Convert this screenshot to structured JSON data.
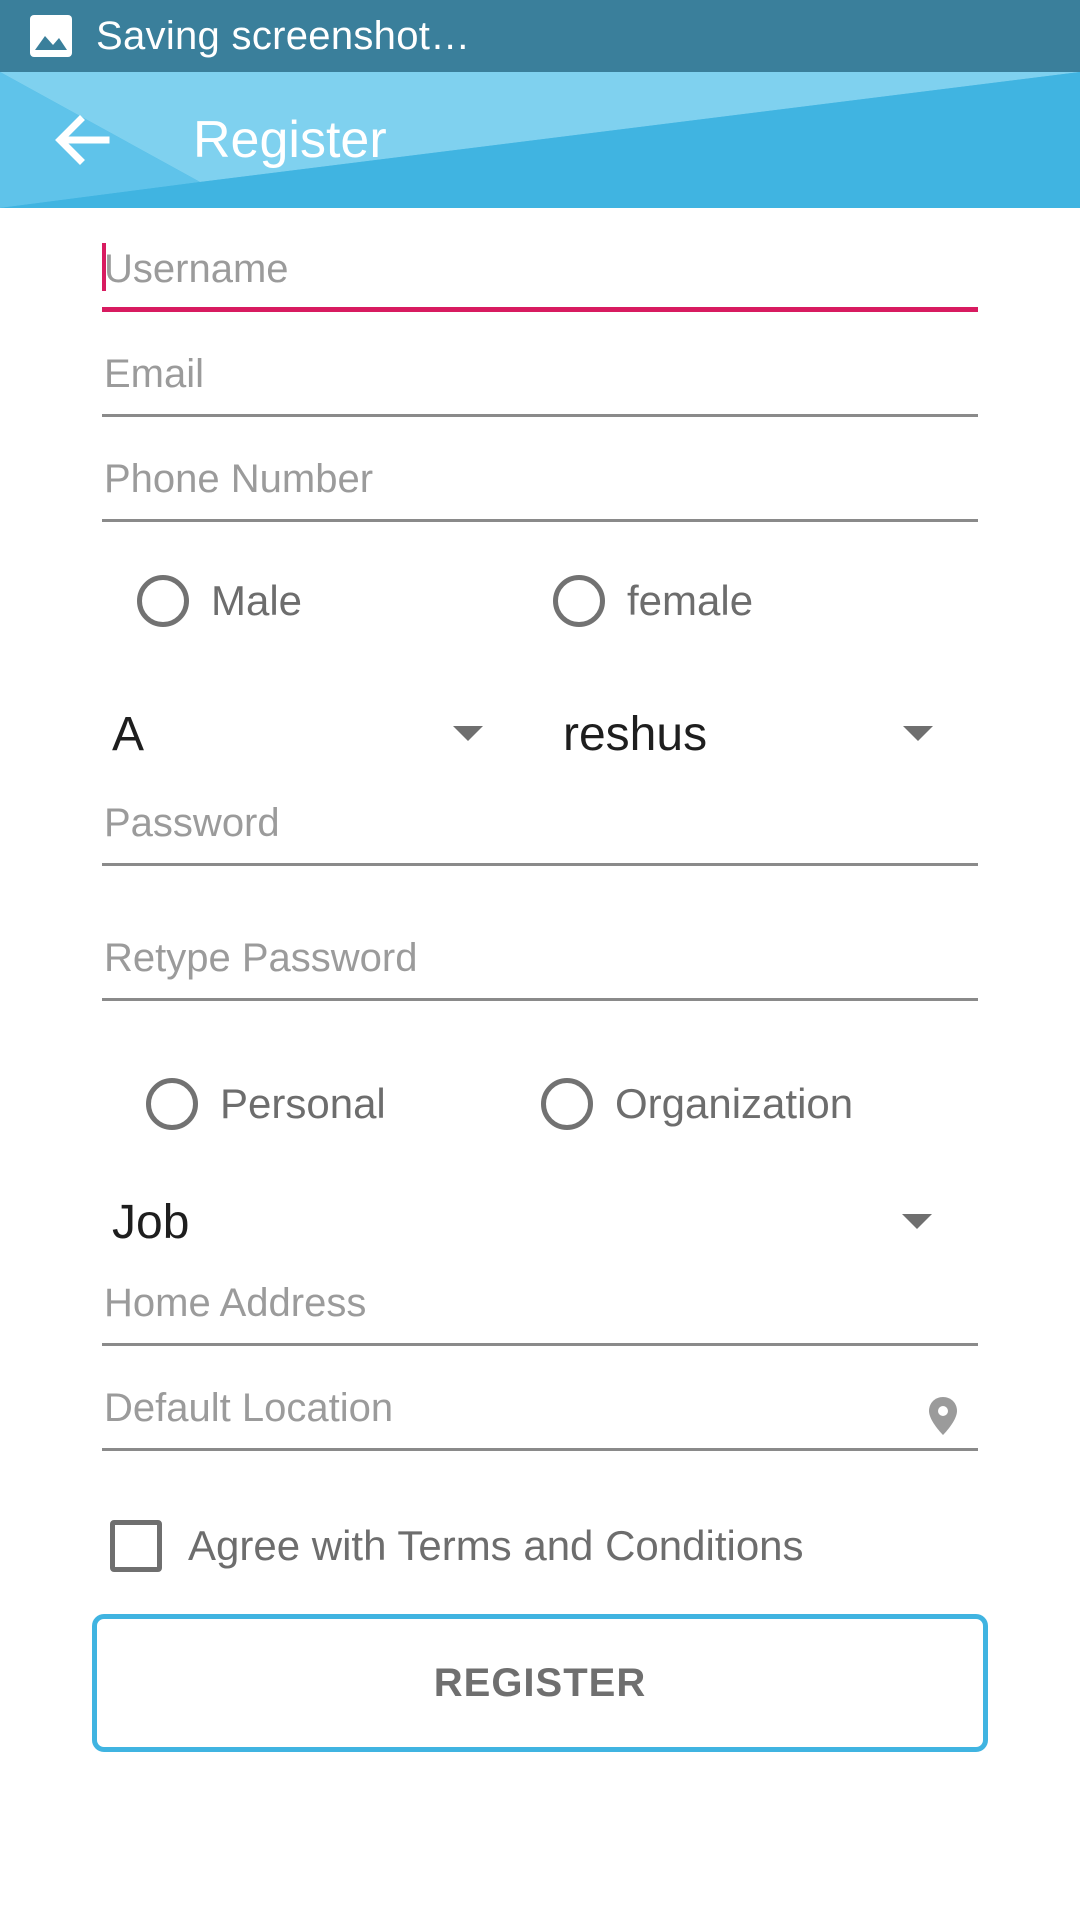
{
  "status_bar": {
    "text": "Saving screenshot…",
    "icon": "image-icon"
  },
  "app_bar": {
    "title": "Register",
    "back_icon": "arrow-left-icon"
  },
  "form": {
    "username": {
      "placeholder": "Username",
      "value": ""
    },
    "email": {
      "placeholder": "Email",
      "value": ""
    },
    "phone": {
      "placeholder": "Phone Number",
      "value": ""
    },
    "gender": {
      "options": [
        "Male",
        "female"
      ]
    },
    "spinner_left": {
      "value": "A"
    },
    "spinner_right": {
      "value": "reshus"
    },
    "password": {
      "placeholder": "Password",
      "value": ""
    },
    "retype_password": {
      "placeholder": "Retype Password",
      "value": ""
    },
    "account_type": {
      "options": [
        "Personal",
        "Organization"
      ]
    },
    "job": {
      "value": "Job"
    },
    "home_address": {
      "placeholder": "Home Address",
      "value": ""
    },
    "default_location": {
      "placeholder": "Default Location",
      "value": "",
      "icon": "location-pin-icon"
    },
    "terms": {
      "label": "Agree with Terms and Conditions",
      "checked": false
    },
    "register_button": {
      "label": "REGISTER"
    }
  },
  "colors": {
    "status_bar": "#3a7f9b",
    "app_bar": "#40b4e1",
    "accent": "#d81b60",
    "button_border": "#40b4e1"
  }
}
